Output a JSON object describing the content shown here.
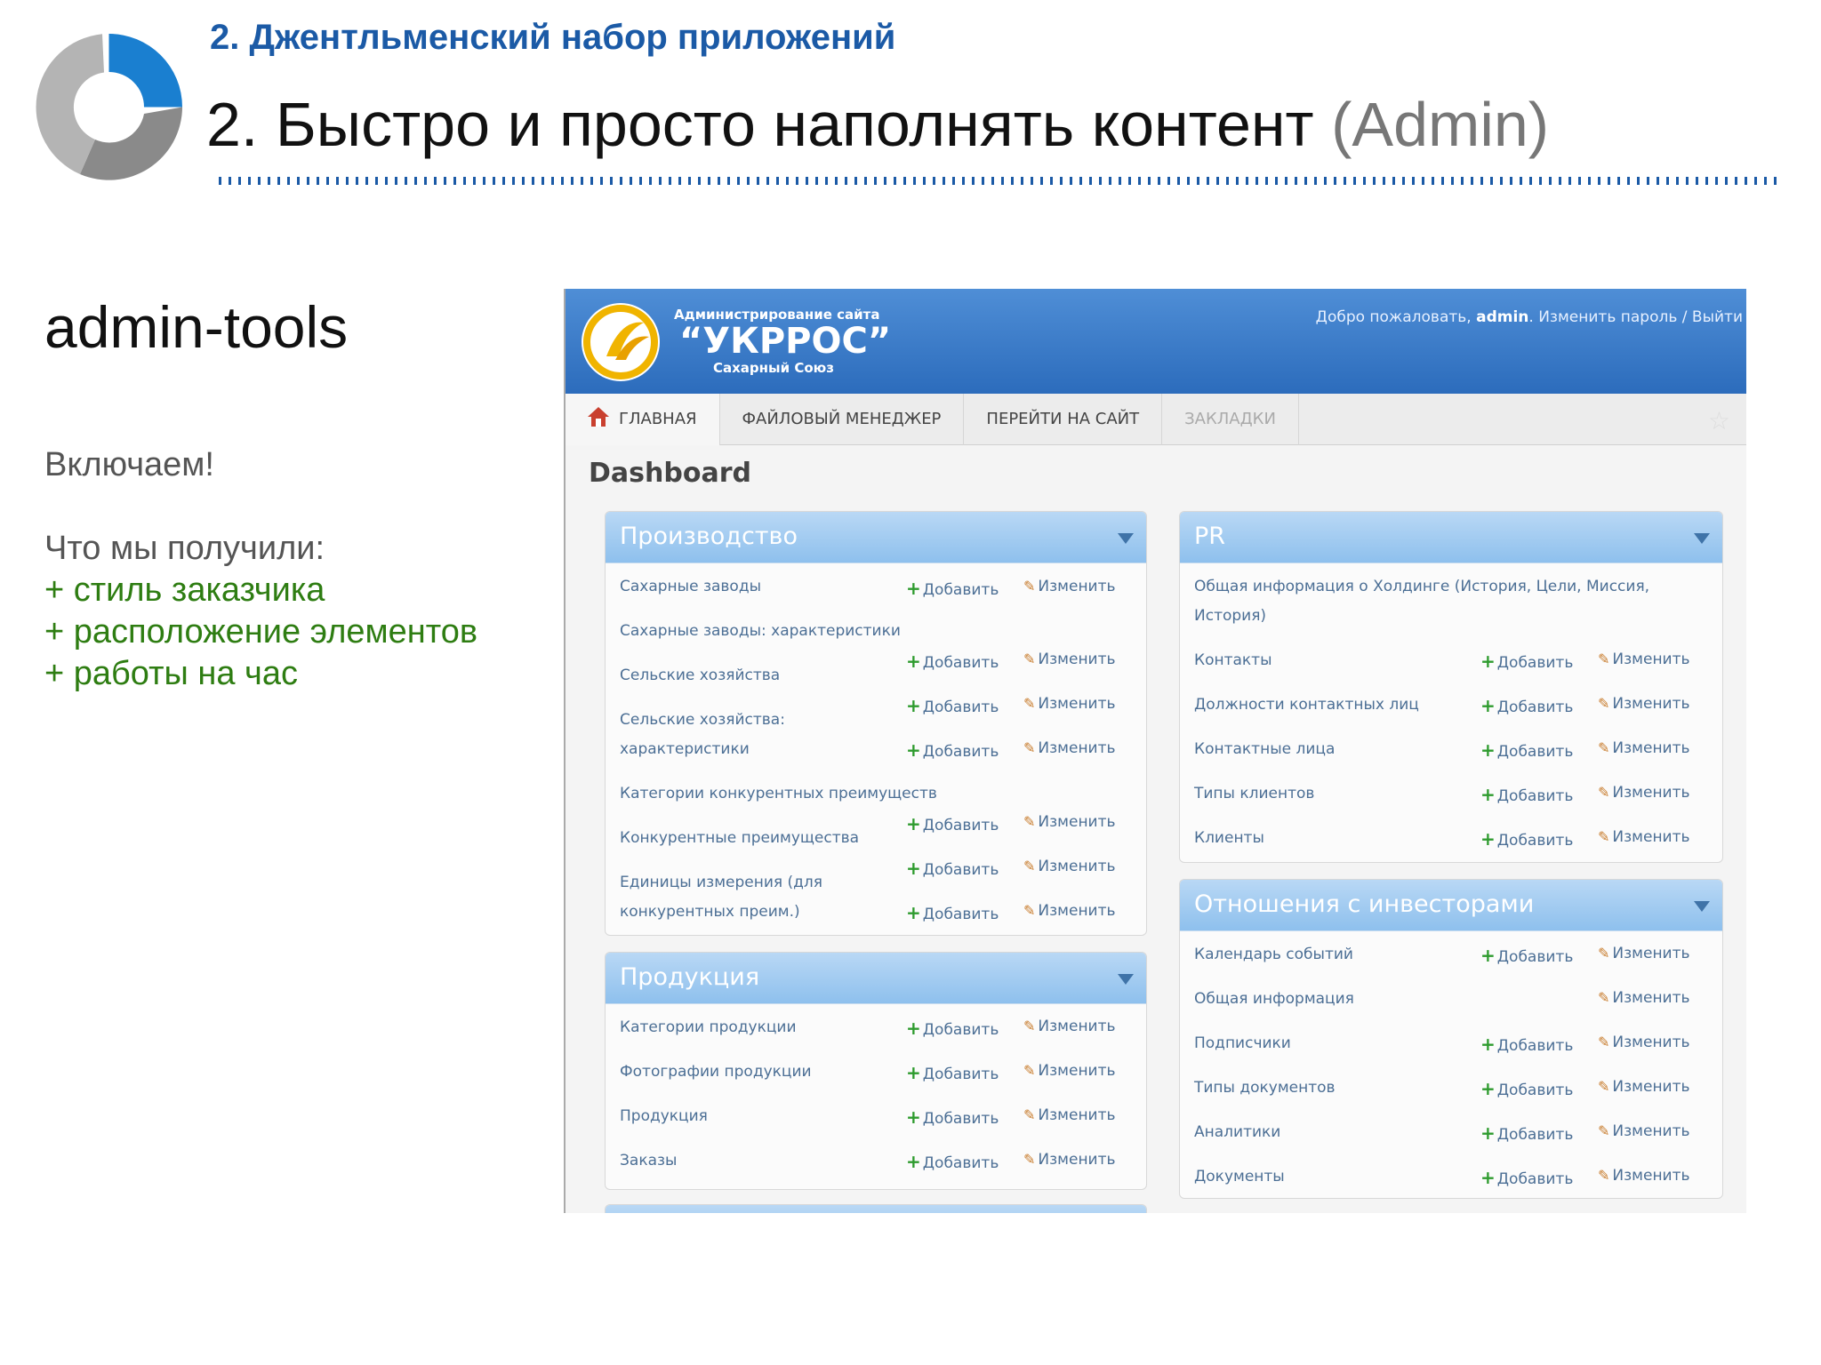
{
  "slide": {
    "subtitle": "2. Джентльменский набор приложений",
    "title_main": "2. Быстро и просто наполнять контент",
    "title_suffix": " (Admin)",
    "left_heading": "admin-tools",
    "left_line1": "Включаем!",
    "left_line2": "Что мы получили:",
    "bullets": [
      "+ стиль заказчика",
      "+ расположение элементов",
      "+ работы на час"
    ]
  },
  "admin": {
    "brand_small": "Администрирование сайта",
    "brand_name": "“УКРРОС”",
    "brand_sub": "Сахарный Союз",
    "welcome": "Добро пожаловать, ",
    "username": "admin",
    "change_password": "Изменить пароль",
    "sep": " / ",
    "logout": "Выйти",
    "nav": [
      "ГЛАВНАЯ",
      "ФАЙЛОВЫЙ МЕНЕДЖЕР",
      "ПЕРЕЙТИ НА САЙТ",
      "ЗАКЛАДКИ"
    ],
    "dashboard_title": "Dashboard",
    "add_label": "Добавить",
    "change_label": "Изменить",
    "modules": {
      "production": {
        "title": "Производство",
        "rows": [
          "Сахарные заводы",
          "Сахарные заводы: характеристики",
          "Сельские хозяйства",
          "Сельские хозяйства:",
          "характеристики",
          "Категории конкурентных преимуществ",
          "Конкурентные преимущества",
          "Единицы измерения (для",
          "конкурентных преим.)"
        ]
      },
      "products": {
        "title": "Продукция",
        "rows": [
          "Категории продукции",
          "Фотографии продукции",
          "Продукция",
          "Заказы"
        ]
      },
      "pr": {
        "title": "PR",
        "rows": [
          "Общая информация о Холдинге (История, Цели, Миссия,",
          "История)",
          "Контакты",
          "Должности контактных лиц",
          "Контактные лица",
          "Типы клиентов",
          "Клиенты"
        ]
      },
      "investors": {
        "title": "Отношения с инвесторами",
        "rows": [
          "Календарь событий",
          "Общая информация",
          "Подписчики",
          "Типы документов",
          "Аналитики",
          "Документы"
        ]
      }
    }
  },
  "colors": {
    "accent_blue": "#1b5aa6",
    "green_text": "#2e7d12",
    "header_blue": "#2c6cbc"
  }
}
